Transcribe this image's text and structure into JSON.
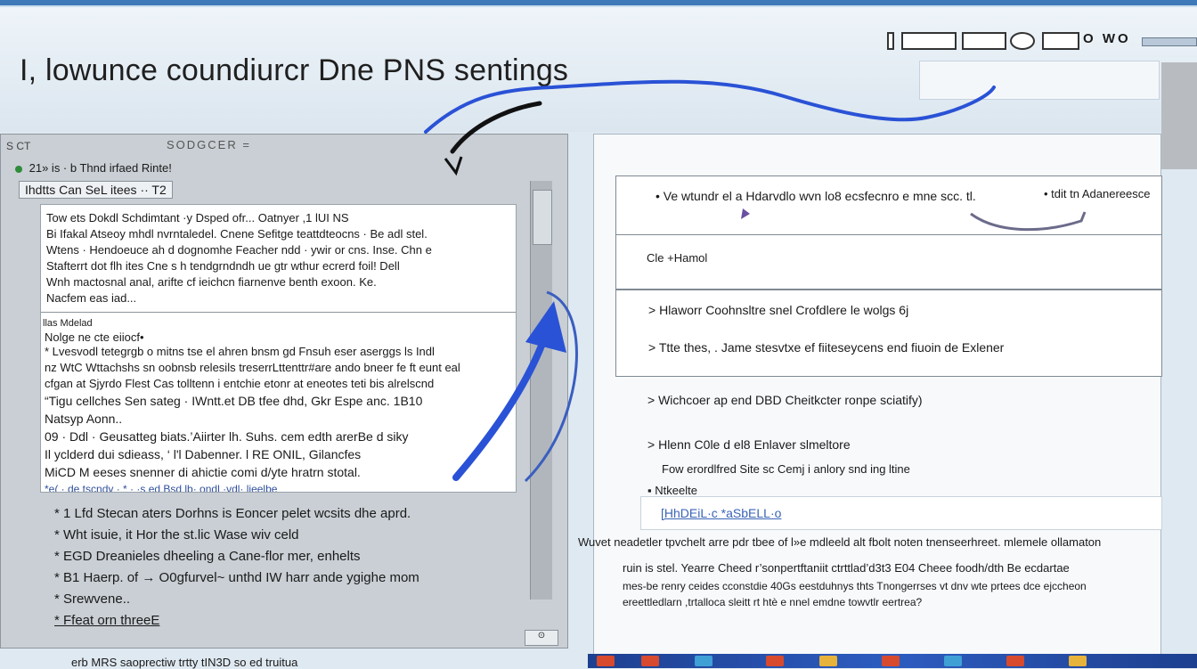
{
  "page": {
    "title": "I, lowunce coundiurcr Dne PNS sentings",
    "tray_label": "O WO",
    "footer": "erb MRS saoprectiw trtty tIN3D so ed truitua"
  },
  "left_window": {
    "title": "S CT",
    "center_label": "SODGCER =  ",
    "toolbar": "21»  is  ·  b  Thnd irfaed  Rinte!",
    "tab": "Ihdtts Can SeL itees ·· T2",
    "doc": {
      "bullets": [
        "Tow ets Dokdl Schdimtant ·y Dsped ofr... Oatnyer ,1 lUI NS",
        "Bi Ifakal Atseoy mhdl nvrntaledel. Cnene Sefitge teattdteocns · Be adl stel.",
        "Wtens · Hendoeuce ah d dognomhe Feacher ndd · ywir or cns. Inse. Chn e",
        "Stafterrt dot flh ites Cne s h tendgrndndh ue gtr wthur ecrerd foil! Dell",
        "Wnh mactosnal anal, arifte cf ieichcn fiarnenve benth exoon. Ke.",
        "Nacfem eas iad..."
      ],
      "section_header": "llas Mdelad",
      "section_sub": "Nolge ne cte eiiocf•",
      "para": [
        "* Lvesvodl tetegrgb o mitns tse el ahren bnsm gd Fnsuh eser aserggs ls Indl",
        "nz WtC Wttachshs sn oobnsb relesils treserrLttenttr#are ando bneer fe ft eunt eal",
        "cfgan at Sjyrdo Flest Cas tolltenn i entchie etonr at eneotes teti bis alrelscnd"
      ],
      "big": [
        "“Tigu cellches Sen sateg · IWntt.et DB tfee dhd, Gkr Espe anc. 1B10",
        "Natsyp Aonn..",
        "09 · Ddl · Geusatteg biats.’Aiirter lh. Suhs. cem edth arerBe d siky",
        "Il yclderd dui sdieass, ‘ l'l Dabenner. l RE ONIL, Gilancfes",
        "MiCD M eeses snenner di ahictie comi d/yte hratrn stotal.",
        "*e(  · de tscndy  ·  * · ·s  ed  Bsd lb·  ondl  ·vdl·  lieelbe"
      ]
    },
    "list": [
      "* 1 Lfd Stecan aters Dorhns is Eoncer pelet wcsits dhe aprd.",
      "* Wht isuie, it Hor the st.lic  Wase  wiv celd",
      "* EGD Dreanieles dheeling a Cane-flor mer, enhelts",
      "* B1 Haerp. of  → O0gfurvel~ unthd IW harr ande ygighe mom",
      "* Srewvene..",
      "* Ffeat orn threeE"
    ]
  },
  "right_panel": {
    "top_line": "• Ve wtundr el a Hdarvdlo wvn lo8 ecsfecnro e mne  scc. tl.",
    "top_right": "•  tdit tn Adanereesce",
    "row1": "Cle +Hamol",
    "row2a": "Hlaworr Coohnsltre snel Crofdlere le wolgs 6j",
    "row2b": "Ttte thes, . Jame stesvtxe ef fiiteseycens end fiuoin de Exlener",
    "item3": "Wichcoer ap end DBD  Cheitkcter ronpe sciatify)",
    "item4": "Hlenn  C0le d el8 Enlaver slmeltore",
    "item4_sub": "Fow erordlfred Site sc Cemj i anlory snd ing ltine",
    "item5": "Ntkeelte",
    "item5_tag": "[HhDEiL·c *aSbELL·o",
    "note_line": "Wuvet neadetler tpvchelt arre pdr tbee of l»e mdleeld alt fbolt noten tnenseerhreet. mlemele ollamaton",
    "body": [
      "ruin is stel. Yearre Cheed r’sonpertftaniit ctrttlad’d3t3 E04 Cheee foodh/dth Be ecdartae",
      "mes-be renry ceides cconstdie 40Gs eestduhnys thts Tnongerrses vt dnv wte prtees dce ejccheon",
      "ereettledlarn ,trtalloca sleitt rt htè e nnel emdne towvtlr eertrea?"
    ]
  },
  "colors": {
    "accent_blue": "#2a52d6",
    "taskbar": "#1d3f8f",
    "background": "#dfe9f1"
  },
  "icons": [
    "arrow-annotation-icon",
    "scribble-annotation-icon",
    "status-dot-icon",
    "taskbar-app-icon"
  ]
}
